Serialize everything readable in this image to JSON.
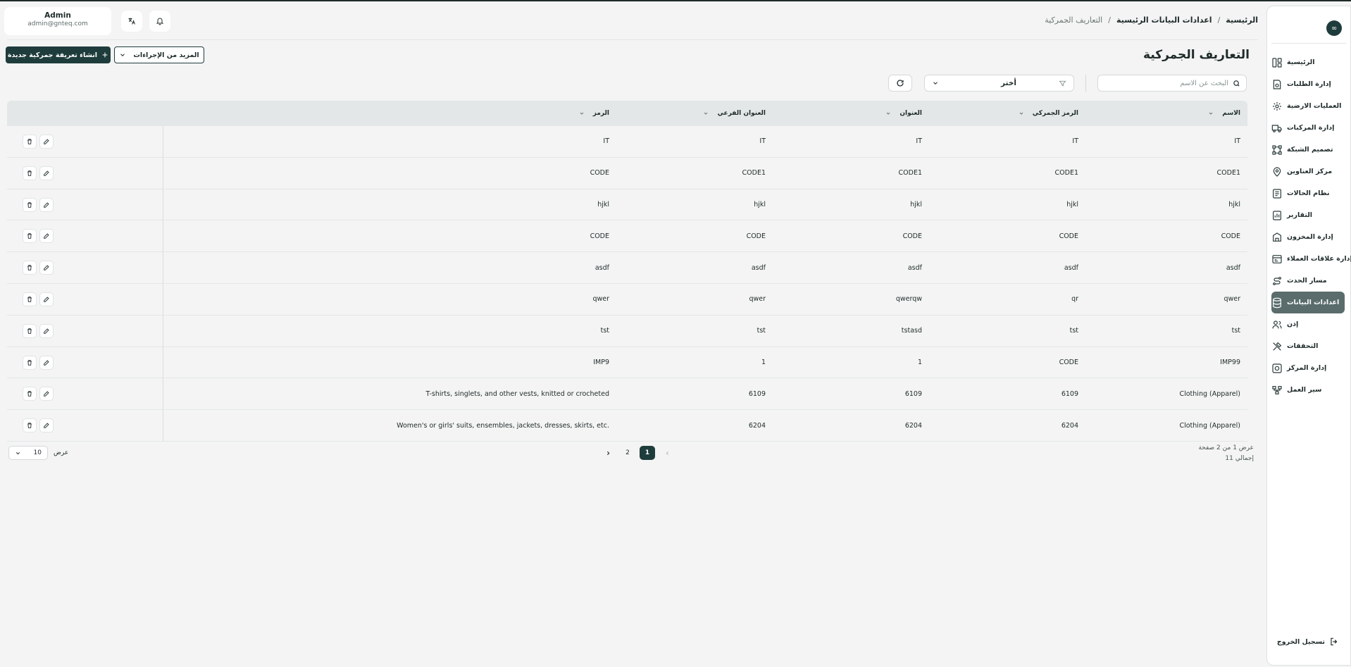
{
  "user": {
    "name": "Admin",
    "email": "admin@gnteq.com"
  },
  "breadcrumbs": [
    "الرئيسية",
    "اعدادات البيانات الرئيسية",
    "التعاريف الجمركية"
  ],
  "breadcrumb_separator": "/",
  "page_title": "التعاريف الجمركية",
  "buttons": {
    "create": "انشاء تعريفة جمركية جديدة",
    "more": "المزيد من الإجراءات"
  },
  "search": {
    "placeholder": "البحث عن الاسم",
    "value": ""
  },
  "filter": {
    "selected": "أختر"
  },
  "sidebar": {
    "logo_glyph": "∞",
    "items": [
      {
        "label": "الرئيسية",
        "icon": "layout-icon",
        "active": false
      },
      {
        "label": "إدارة الطلبات",
        "icon": "orders-icon",
        "active": false
      },
      {
        "label": "العمليات الارضية",
        "icon": "ground-ops-icon",
        "active": false
      },
      {
        "label": "إدارة المركبات",
        "icon": "truck-icon",
        "active": false
      },
      {
        "label": "تصميم الشبكة",
        "icon": "network-icon",
        "active": false
      },
      {
        "label": "مركز العناوين",
        "icon": "location-icon",
        "active": false
      },
      {
        "label": "نظام الحالات",
        "icon": "status-icon",
        "active": false
      },
      {
        "label": "التقارير",
        "icon": "report-icon",
        "active": false
      },
      {
        "label": "إدارة المخزون",
        "icon": "inventory-icon",
        "active": false
      },
      {
        "label": "إدارة علاقات العملاء",
        "icon": "crm-icon",
        "active": false
      },
      {
        "label": "مسار الحدث",
        "icon": "route-icon",
        "active": false
      },
      {
        "label": "اعدادات البيانات",
        "icon": "database-icon",
        "active": true
      },
      {
        "label": "إذن",
        "icon": "users-icon",
        "active": false
      },
      {
        "label": "التحققات",
        "icon": "tools-icon",
        "active": false
      },
      {
        "label": "إدارة المركز",
        "icon": "hub-icon",
        "active": false
      },
      {
        "label": "سير العمل",
        "icon": "workflow-icon",
        "active": false
      }
    ],
    "logout": "تسجيل الخروج"
  },
  "table": {
    "headers": [
      "الاسم",
      "الرمز الجمركي",
      "العنوان",
      "العنوان الفرعي",
      "الرمز"
    ],
    "rows": [
      [
        "IT",
        "IT",
        "IT",
        "IT",
        "IT"
      ],
      [
        "CODE1",
        "CODE1",
        "CODE1",
        "CODE1",
        "CODE"
      ],
      [
        "hjkl",
        "hjkl",
        "hjkl",
        "hjkl",
        "hjkl"
      ],
      [
        "CODE",
        "CODE",
        "CODE",
        "CODE",
        "CODE"
      ],
      [
        "asdf",
        "asdf",
        "asdf",
        "asdf",
        "asdf"
      ],
      [
        "qwer",
        "qr",
        "qwerqw",
        "qwer",
        "qwer"
      ],
      [
        "tst",
        "tst",
        "tstasd",
        "tst",
        "tst"
      ],
      [
        "IMP99",
        "CODE",
        "1",
        "1",
        "IMP9"
      ],
      [
        "Clothing (Apparel)",
        "6109",
        "6109",
        "6109",
        "T-shirts, singlets, and other vests, knitted or crocheted"
      ],
      [
        "Clothing (Apparel)",
        "6204",
        "6204",
        "6204",
        "Women's or girls' suits, ensembles, jackets, dresses, skirts, etc."
      ]
    ]
  },
  "footer": {
    "page_info": "عرض 1 من 2 صفحة",
    "total": "إجمالي 11",
    "pages": [
      "1",
      "2"
    ],
    "current_page": "1",
    "per_page_label": "عرض",
    "per_page_value": "10"
  }
}
